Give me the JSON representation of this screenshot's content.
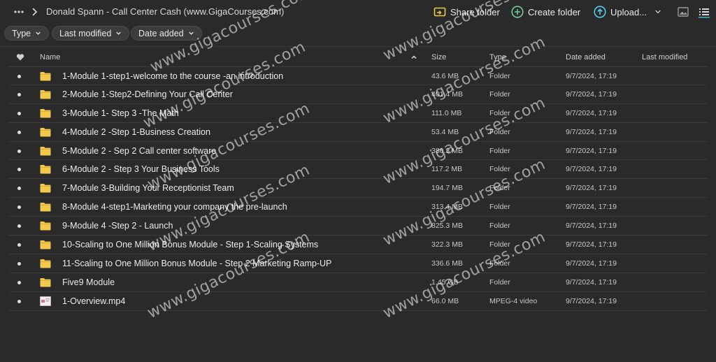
{
  "breadcrumb": {
    "title": "Donald Spann - Call Center Cash (www.GigaCourses.com)"
  },
  "toolbar": {
    "share_label": "Share folder",
    "create_label": "Create folder",
    "upload_label": "Upload..."
  },
  "filters": [
    {
      "label": "Type"
    },
    {
      "label": "Last modified"
    },
    {
      "label": "Date added"
    }
  ],
  "columns": {
    "name": "Name",
    "size": "Size",
    "type": "Type",
    "date_added": "Date added",
    "last_modified": "Last modified"
  },
  "files": [
    {
      "name": "1-Module 1-step1-welcome to the course -an introduction",
      "size": "43.6 MB",
      "type": "Folder",
      "date_added": "9/7/2024, 17:19",
      "last_modified": "",
      "icon": "folder-icon"
    },
    {
      "name": "2-Module 1-Step2-Defining Your Call Center",
      "size": "401.4 MB",
      "type": "Folder",
      "date_added": "9/7/2024, 17:19",
      "last_modified": "",
      "icon": "folder-icon"
    },
    {
      "name": "3-Module 1- Step 3 -The Math",
      "size": "111.0 MB",
      "type": "Folder",
      "date_added": "9/7/2024, 17:19",
      "last_modified": "",
      "icon": "folder-icon"
    },
    {
      "name": "4-Module 2 -Step 1-Business Creation",
      "size": "53.4 MB",
      "type": "Folder",
      "date_added": "9/7/2024, 17:19",
      "last_modified": "",
      "icon": "folder-icon"
    },
    {
      "name": "5-Module 2 - Sep 2 Call center software",
      "size": "380.3 MB",
      "type": "Folder",
      "date_added": "9/7/2024, 17:19",
      "last_modified": "",
      "icon": "folder-icon"
    },
    {
      "name": "6-Module 2 - Step 3 Your Business Tools",
      "size": "117.2 MB",
      "type": "Folder",
      "date_added": "9/7/2024, 17:19",
      "last_modified": "",
      "icon": "folder-icon"
    },
    {
      "name": "7-Module 3-Building Your Receptionist Team",
      "size": "194.7 MB",
      "type": "Folder",
      "date_added": "9/7/2024, 17:19",
      "last_modified": "",
      "icon": "folder-icon"
    },
    {
      "name": "8-Module 4-step1-Marketing your company the pre-launch",
      "size": "313.4 MB",
      "type": "Folder",
      "date_added": "9/7/2024, 17:19",
      "last_modified": "",
      "icon": "folder-icon"
    },
    {
      "name": "9-Module 4 -Step 2 - Launch",
      "size": "825.3 MB",
      "type": "Folder",
      "date_added": "9/7/2024, 17:19",
      "last_modified": "",
      "icon": "folder-icon"
    },
    {
      "name": "10-Scaling to One Million Bonus Module - Step 1-Scaling Systems",
      "size": "322.3 MB",
      "type": "Folder",
      "date_added": "9/7/2024, 17:19",
      "last_modified": "",
      "icon": "folder-icon"
    },
    {
      "name": "11-Scaling to One Million Bonus Module - Step 2 Marketing Ramp-UP",
      "size": "336.6 MB",
      "type": "Folder",
      "date_added": "9/7/2024, 17:19",
      "last_modified": "",
      "icon": "folder-icon"
    },
    {
      "name": "Five9 Module",
      "size": "1.45 GB",
      "type": "Folder",
      "date_added": "9/7/2024, 17:19",
      "last_modified": "",
      "icon": "folder-icon"
    },
    {
      "name": "1-Overview.mp4",
      "size": "66.0 MB",
      "type": "MPEG-4 video",
      "date_added": "9/7/2024, 17:19",
      "last_modified": "",
      "icon": "video-thumbnail-icon"
    }
  ],
  "watermark": {
    "text": "www.gigacourses.com"
  },
  "colors": {
    "background": "#2a2a2a",
    "folder": "#f2c94c",
    "share_icon": "#f2c94c",
    "create_icon": "#6fcf97",
    "upload_icon": "#56ccf2"
  }
}
